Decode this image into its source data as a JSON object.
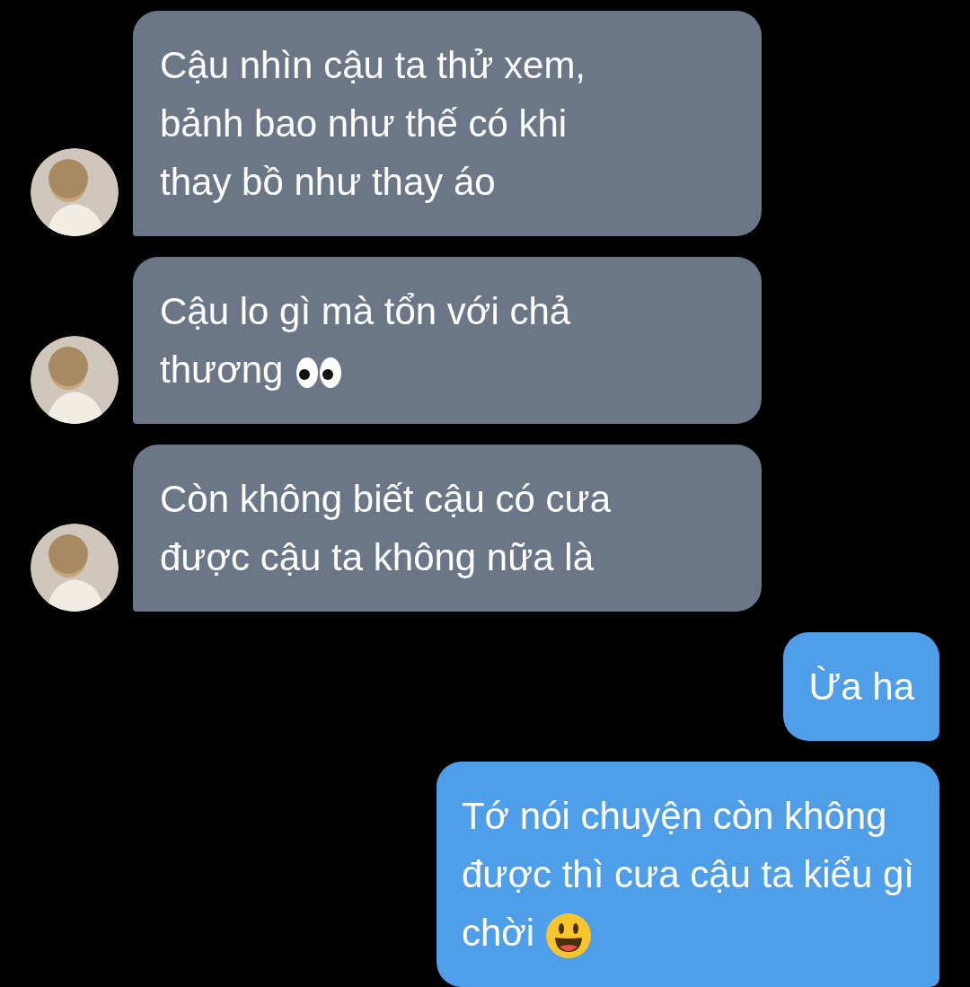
{
  "messages": [
    {
      "kind": "incoming",
      "text": "Cậu nhìn cậu ta thử xem,\nbảnh bao như thế có khi\nthay bồ như thay áo"
    },
    {
      "kind": "incoming",
      "text": "Cậu lo gì mà tổn với chả\nthương",
      "emoji": {
        "kind": "eyes"
      }
    },
    {
      "kind": "incoming",
      "text": "Còn không biết cậu có cưa\nđược cậu ta không nữa là"
    },
    {
      "kind": "outgoing",
      "text": "Ừa ha"
    },
    {
      "kind": "outgoing",
      "text": "Tớ nói chuyện còn không\nđược thì cưa cậu ta kiểu gì\nchời",
      "emoji": {
        "kind": "smile"
      }
    }
  ]
}
